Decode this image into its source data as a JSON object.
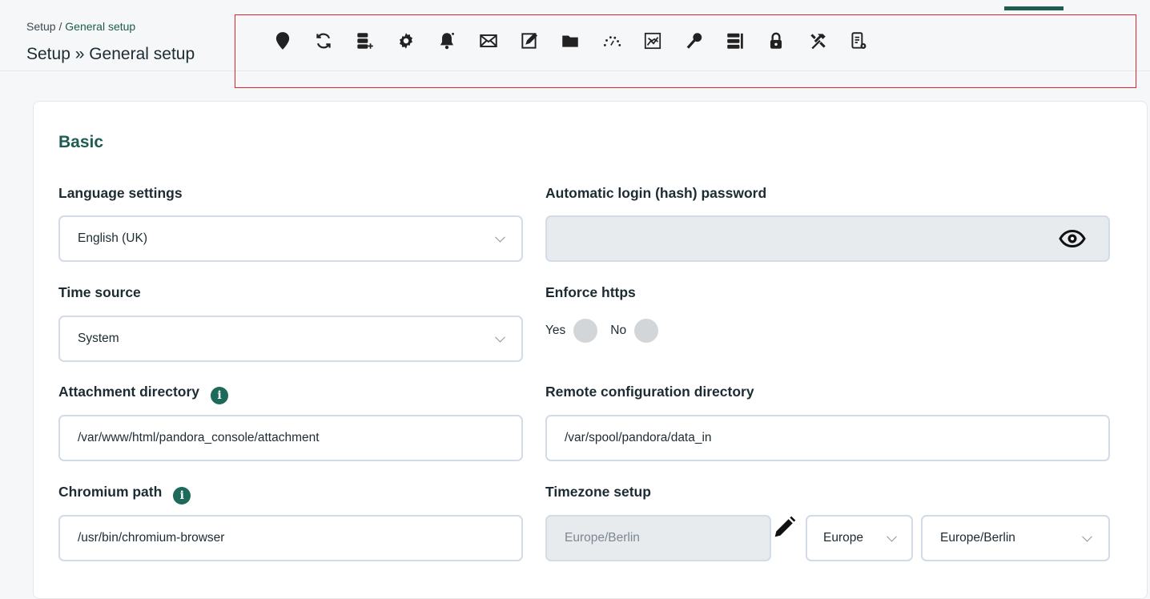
{
  "breadcrumb": {
    "parent": "Setup",
    "separator": " / ",
    "current": "General setup"
  },
  "page_title": "Setup » General setup",
  "toolbar": {
    "icons": [
      "location-pin-icon",
      "sync-icon",
      "database-add-icon",
      "gear-icon",
      "bell-icon",
      "mail-icon",
      "edit-note-icon",
      "folder-icon",
      "gauge-icon",
      "chart-icon",
      "key-icon",
      "server-list-icon",
      "lock-icon",
      "tools-icon",
      "report-settings-icon"
    ]
  },
  "section": {
    "title": "Basic"
  },
  "form": {
    "language": {
      "label": "Language settings",
      "value": "English (UK)"
    },
    "autologin": {
      "label": "Automatic login (hash) password",
      "value": ""
    },
    "time_source": {
      "label": "Time source",
      "value": "System"
    },
    "enforce_https": {
      "label": "Enforce https",
      "yes": "Yes",
      "no": "No"
    },
    "attachment_dir": {
      "label": "Attachment directory",
      "value": "/var/www/html/pandora_console/attachment"
    },
    "remote_config_dir": {
      "label": "Remote configuration directory",
      "value": "/var/spool/pandora/data_in"
    },
    "chromium_path": {
      "label": "Chromium path",
      "value": "/usr/bin/chromium-browser"
    },
    "timezone": {
      "label": "Timezone setup",
      "current": "Europe/Berlin",
      "region": "Europe",
      "zone": "Europe/Berlin"
    },
    "info_glyph": "i"
  },
  "colors": {
    "accent": "#1d5c50",
    "highlight_border": "#e0242f"
  }
}
